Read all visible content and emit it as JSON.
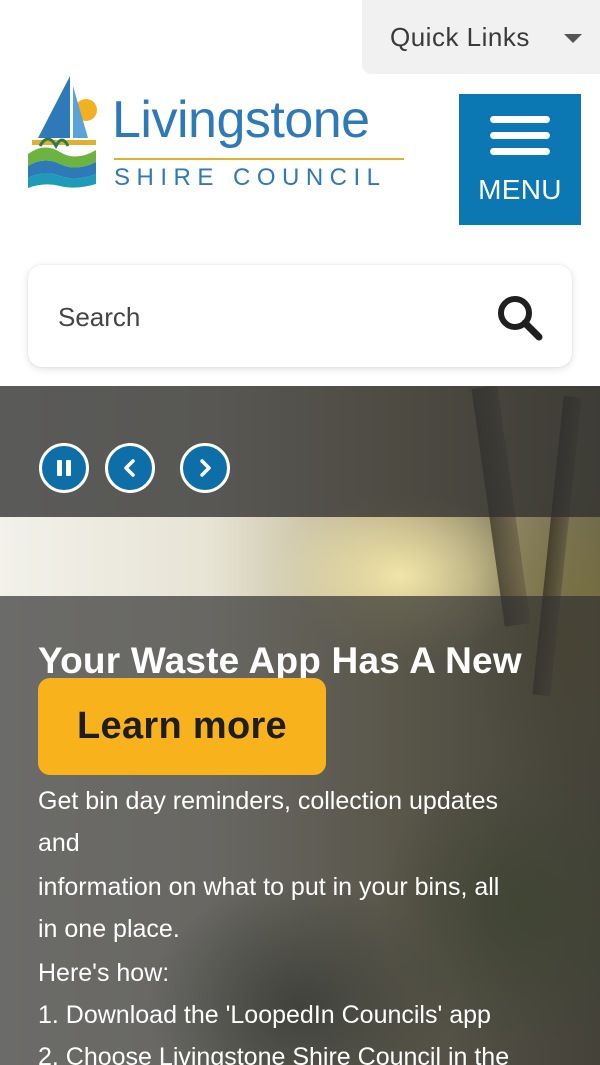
{
  "header": {
    "quick_links_label": "Quick Links",
    "logo": {
      "name": "Livingstone",
      "subtitle": "SHIRE COUNCIL"
    },
    "menu_label": "MENU"
  },
  "search": {
    "placeholder": "Search"
  },
  "hero": {
    "slide_title": "Your Waste App Has A New",
    "cta_label": "Learn more",
    "body_lines": [
      "Get bin day reminders, collection updates",
      "and",
      "information on what to put in your bins, all",
      "in one place.",
      "Here's how:",
      "1. Download the 'LoopedIn Councils' app",
      "2. Choose Livingstone Shire Council in the"
    ]
  },
  "colors": {
    "brand_blue": "#0b77b3",
    "logo_blue": "#2e79b7",
    "accent_yellow": "#f8b21b",
    "quick_links_bg": "#f1f1f1"
  },
  "icons": {
    "quick_links_caret": "caret-down-icon",
    "menu": "hamburger-icon",
    "search": "search-icon",
    "pause": "pause-icon",
    "prev": "chevron-left-icon",
    "next": "chevron-right-icon"
  }
}
